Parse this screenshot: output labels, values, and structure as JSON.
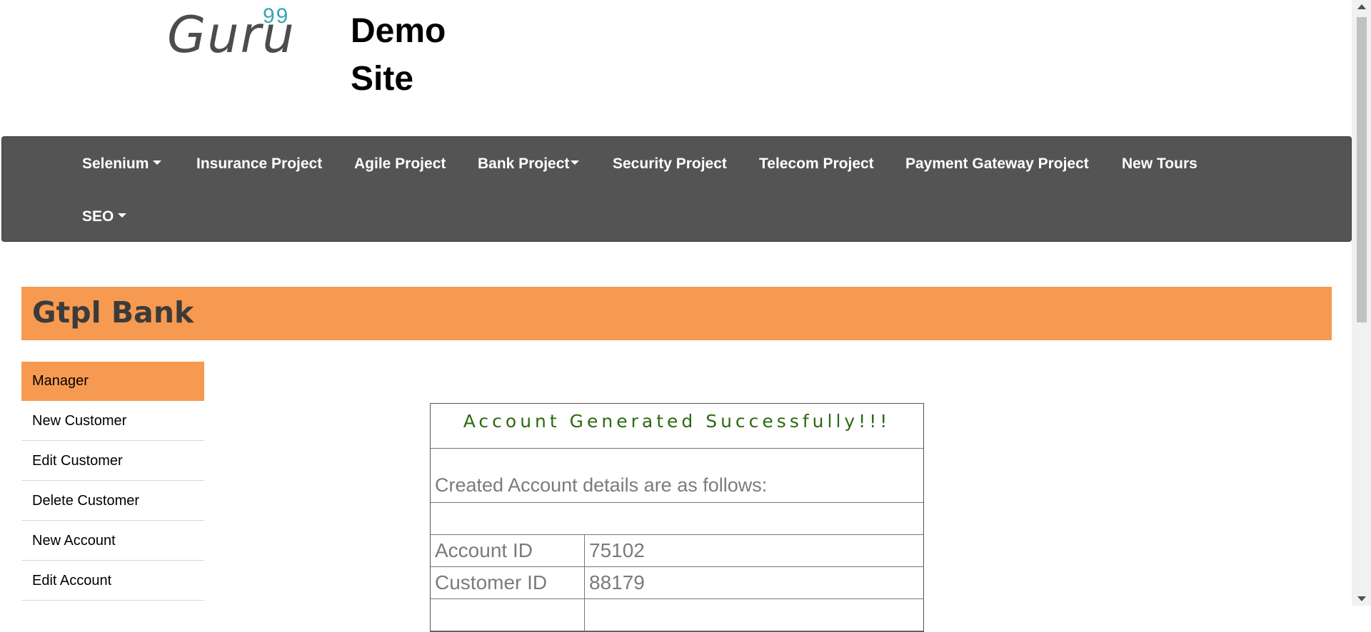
{
  "header": {
    "logo_text": "Guru",
    "logo_sup": "99",
    "site_title_line1": "Demo",
    "site_title_line2": "Site"
  },
  "nav": {
    "items": [
      {
        "label": "Selenium",
        "dropdown": true
      },
      {
        "label": "Insurance Project",
        "dropdown": false
      },
      {
        "label": "Agile Project",
        "dropdown": false
      },
      {
        "label": "Bank Project",
        "dropdown": true
      },
      {
        "label": "Security Project",
        "dropdown": false
      },
      {
        "label": "Telecom Project",
        "dropdown": false
      },
      {
        "label": "Payment Gateway Project",
        "dropdown": false
      },
      {
        "label": "New Tours",
        "dropdown": false
      },
      {
        "label": "SEO",
        "dropdown": true
      }
    ]
  },
  "bank": {
    "title": "Gtpl Bank"
  },
  "sidebar": {
    "items": [
      {
        "label": "Manager",
        "active": true
      },
      {
        "label": "New Customer"
      },
      {
        "label": "Edit Customer"
      },
      {
        "label": "Delete Customer"
      },
      {
        "label": "New Account"
      },
      {
        "label": "Edit Account"
      }
    ]
  },
  "result": {
    "heading": "Account Generated Successfully!!!",
    "subheading": "Created Account details are as follows:",
    "rows": [
      {
        "key": "Account ID",
        "value": "75102"
      },
      {
        "key": "Customer ID",
        "value": "88179"
      }
    ]
  },
  "colors": {
    "accent": "#f79a51",
    "nav_bg": "#545454",
    "success_text": "#2d6a10",
    "logo_sup": "#3aa3b5"
  }
}
